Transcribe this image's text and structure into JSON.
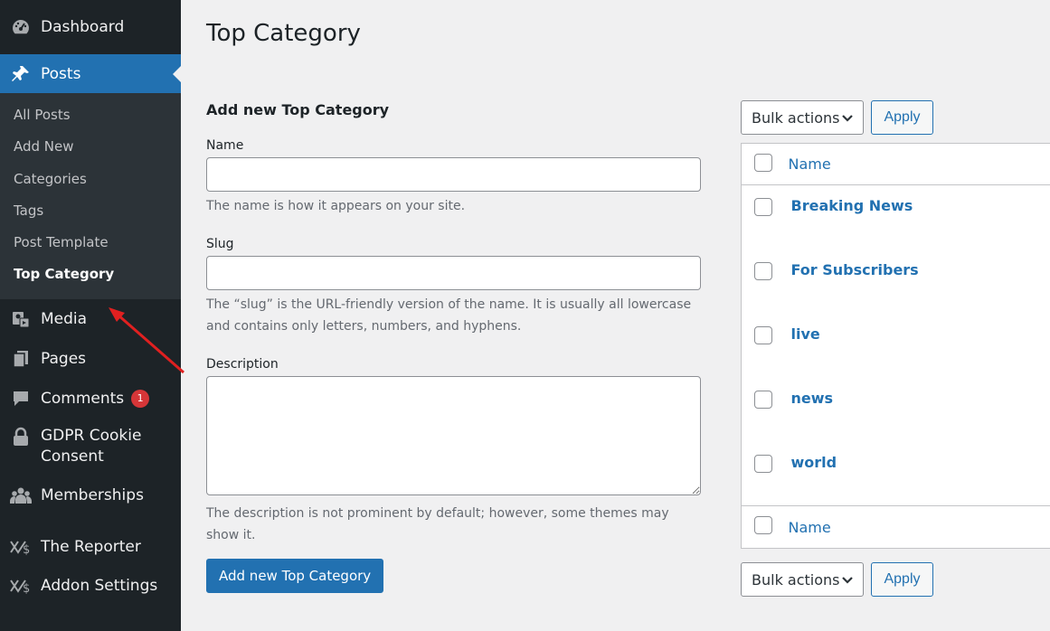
{
  "sidebar": {
    "dashboard": "Dashboard",
    "posts": "Posts",
    "submenu": [
      "All Posts",
      "Add New",
      "Categories",
      "Tags",
      "Post Template",
      "Top Category"
    ],
    "media": "Media",
    "pages": "Pages",
    "comments": "Comments",
    "comments_badge": "1",
    "gdpr_line1": "GDPR Cookie",
    "gdpr_line2": "Consent",
    "memberships": "Memberships",
    "reporter": "The Reporter",
    "addon": "Addon Settings"
  },
  "page": {
    "title": "Top Category"
  },
  "form": {
    "heading": "Add new Top Category",
    "name_label": "Name",
    "name_value": "",
    "name_desc": "The name is how it appears on your site.",
    "slug_label": "Slug",
    "slug_value": "",
    "slug_desc_1": "The “slug” is the URL-friendly version of the name. It is usually all lowercase",
    "slug_desc_2": "and contains only letters, numbers, and hyphens.",
    "description_label": "Description",
    "description_value": "",
    "description_desc_1": "The description is not prominent by default; however, some themes may",
    "description_desc_2": "show it.",
    "submit": "Add new Top Category"
  },
  "table": {
    "bulk_actions": "Bulk actions",
    "apply": "Apply",
    "column_name": "Name",
    "rows": [
      "Breaking News",
      "For Subscribers",
      "live",
      "news",
      "world"
    ]
  },
  "colors": {
    "accent": "#2271b1",
    "sidebar_bg": "#1d2327",
    "submenu_bg": "#2c3338",
    "badge": "#d63638",
    "arrow": "#e02020"
  },
  "icons": [
    "dashboard-icon",
    "pin-icon",
    "media-icon",
    "pages-icon",
    "comments-icon",
    "lock-icon",
    "memberships-icon",
    "reporter-icon",
    "addon-icon",
    "chevron-down-icon"
  ]
}
